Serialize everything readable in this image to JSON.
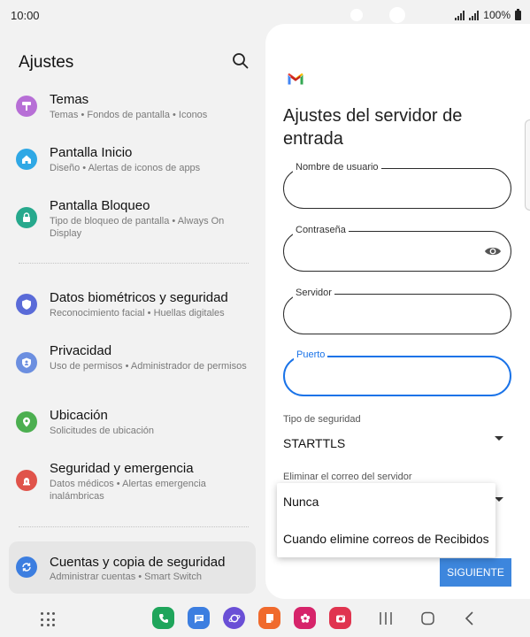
{
  "status_bar": {
    "time": "10:00",
    "battery": "100%"
  },
  "left_pane": {
    "title": "Ajustes",
    "items": [
      {
        "title": "Temas",
        "subtitle": "Temas • Fondos de pantalla • Iconos",
        "icon": "paint-roller-icon",
        "color": "#b76fd6"
      },
      {
        "title": "Pantalla Inicio",
        "subtitle": "Diseño • Alertas de iconos de apps",
        "icon": "home-icon",
        "color": "#2fa8e5"
      },
      {
        "title": "Pantalla Bloqueo",
        "subtitle": "Tipo de bloqueo de pantalla • Always On Display",
        "icon": "lock-icon",
        "color": "#27a98d"
      },
      {
        "title": "Datos biométricos y seguridad",
        "subtitle": "Reconocimiento facial • Huellas digitales",
        "icon": "shield-icon",
        "color": "#5a6bd8"
      },
      {
        "title": "Privacidad",
        "subtitle": "Uso de permisos • Administrador de permisos",
        "icon": "privacy-shield-icon",
        "color": "#6c8fe0"
      },
      {
        "title": "Ubicación",
        "subtitle": "Solicitudes de ubicación",
        "icon": "location-pin-icon",
        "color": "#4caf50"
      },
      {
        "title": "Seguridad y emergencia",
        "subtitle": "Datos médicos • Alertas emergencia inalámbricas",
        "icon": "emergency-icon",
        "color": "#e0534a"
      },
      {
        "title": "Cuentas y copia de seguridad",
        "subtitle": "Administrar cuentas • Smart Switch",
        "icon": "sync-icon",
        "color": "#3c7ee0",
        "selected": true
      }
    ]
  },
  "right_panel": {
    "title": "Ajustes del servidor de entrada",
    "fields": {
      "username": {
        "label": "Nombre de usuario",
        "value": ""
      },
      "password": {
        "label": "Contraseña",
        "value": ""
      },
      "server": {
        "label": "Servidor",
        "value": ""
      },
      "port": {
        "label": "Puerto",
        "value": "",
        "focused": true
      }
    },
    "security_type": {
      "label": "Tipo de seguridad",
      "value": "STARTTLS"
    },
    "delete_mail": {
      "label": "Eliminar el correo del servidor"
    },
    "next_button": "SIGUIENTE",
    "accent_color": "#1a73e8"
  },
  "dropdown": {
    "options": [
      "Nunca",
      "Cuando elimine correos de Recibidos"
    ]
  },
  "dock": {
    "apps": [
      {
        "name": "phone",
        "icon": "phone-icon",
        "color": "#1fa55b"
      },
      {
        "name": "messages",
        "icon": "message-icon",
        "color": "#3c7ee0"
      },
      {
        "name": "internet",
        "icon": "internet-icon",
        "color": "#6a4fd6"
      },
      {
        "name": "notes",
        "icon": "notes-icon",
        "color": "#f06a2c"
      },
      {
        "name": "gallery",
        "icon": "flower-icon",
        "color": "#d6246a"
      },
      {
        "name": "camera",
        "icon": "camera-icon",
        "color": "#e0344f"
      }
    ]
  }
}
